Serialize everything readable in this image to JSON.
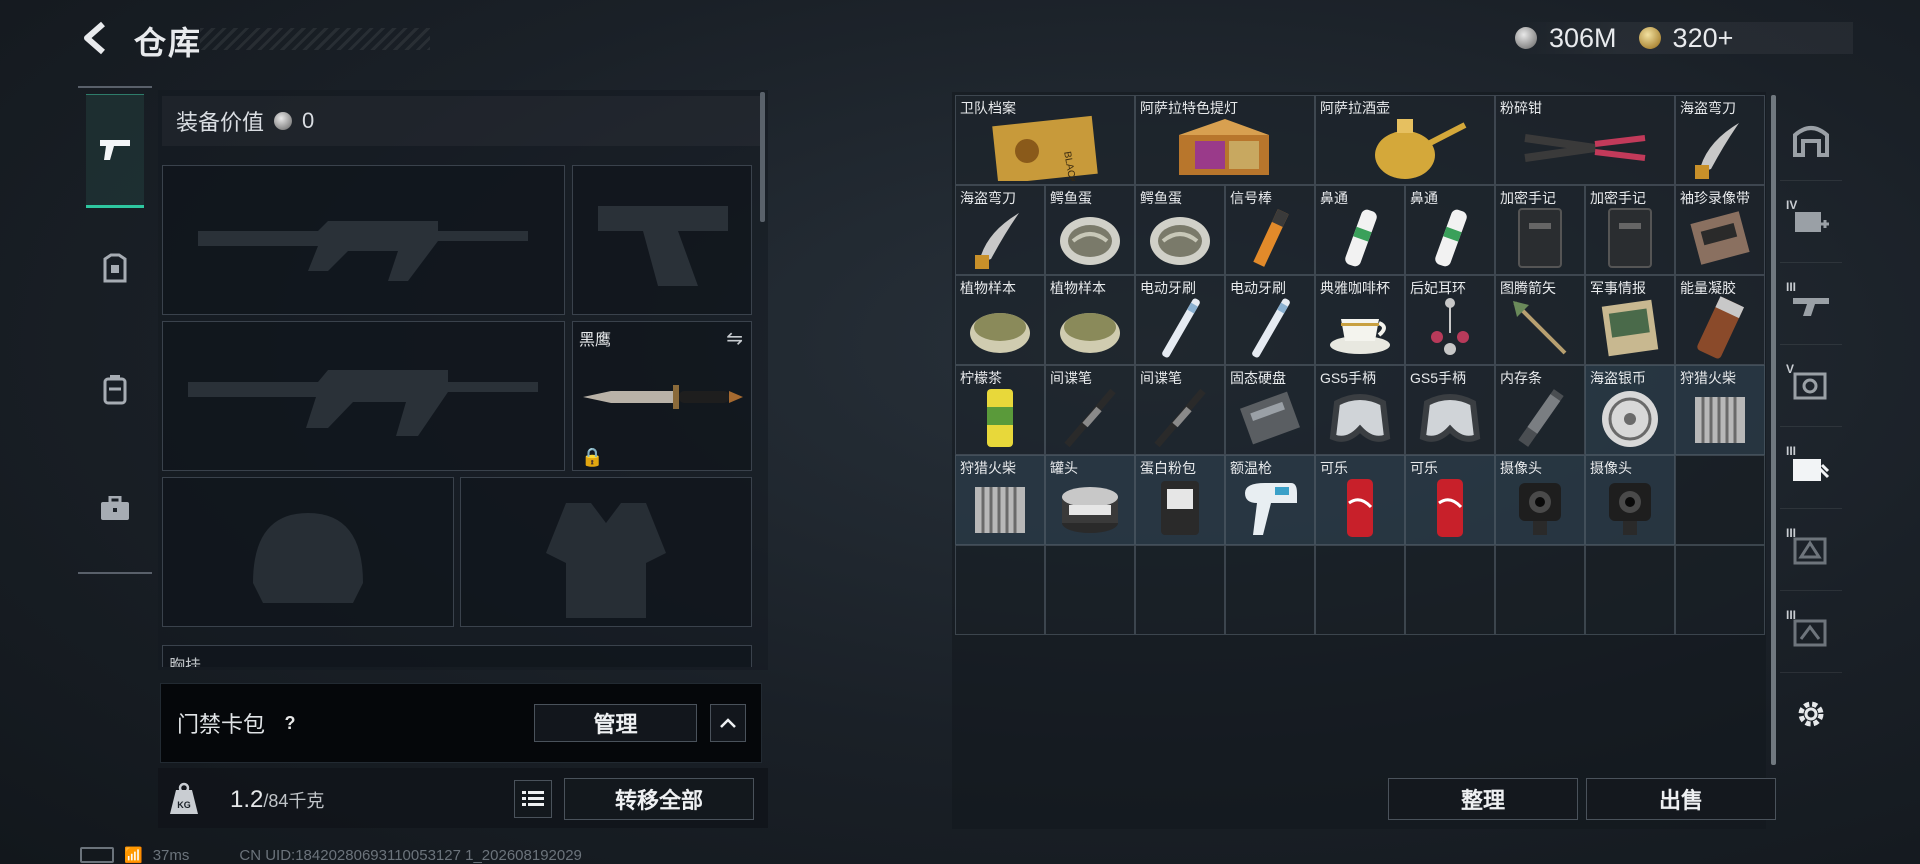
{
  "header": {
    "title": "仓库",
    "silver_amount": "306M",
    "gold_amount": "320+"
  },
  "equipment": {
    "value_label": "装备价值",
    "value": "0",
    "melee_name": "黑鹰",
    "chest_label": "胸挂"
  },
  "card_pack": {
    "label": "门禁卡包",
    "manage_label": "管理"
  },
  "bottom": {
    "weight_current": "1.2",
    "weight_max": "/84千克",
    "transfer_all_label": "转移全部"
  },
  "status": {
    "ping": "37ms",
    "uid": "CN UID:18420280693110053127 1_202608192029"
  },
  "inventory": {
    "items": [
      {
        "name": "卫队档案",
        "icon": "dossier-icon",
        "wide": true,
        "blue": false
      },
      {
        "name": "阿萨拉特色提灯",
        "icon": "lantern-icon",
        "wide": true,
        "blue": false
      },
      {
        "name": "阿萨拉酒壶",
        "icon": "wine-jug-icon",
        "wide": true,
        "blue": false
      },
      {
        "name": "粉碎钳",
        "icon": "pliers-icon",
        "wide": true,
        "blue": false
      },
      {
        "name": "海盗弯刀",
        "icon": "scimitar-icon",
        "wide": false,
        "blue": false
      },
      {
        "name": "海盗弯刀",
        "icon": "scimitar-icon",
        "wide": false,
        "blue": false
      },
      {
        "name": "鳄鱼蛋",
        "icon": "egg-icon",
        "wide": false,
        "blue": false
      },
      {
        "name": "鳄鱼蛋",
        "icon": "egg-icon",
        "wide": false,
        "blue": false
      },
      {
        "name": "信号棒",
        "icon": "flare-icon",
        "wide": false,
        "blue": false
      },
      {
        "name": "鼻通",
        "icon": "inhaler-icon",
        "wide": false,
        "blue": false
      },
      {
        "name": "鼻通",
        "icon": "inhaler-icon",
        "wide": false,
        "blue": false
      },
      {
        "name": "加密手记",
        "icon": "notebook-icon",
        "wide": false,
        "blue": false
      },
      {
        "name": "加密手记",
        "icon": "notebook-icon",
        "wide": false,
        "blue": false
      },
      {
        "name": "袖珍录像带",
        "icon": "tape-icon",
        "wide": false,
        "blue": false
      },
      {
        "name": "植物样本",
        "icon": "sample-jar-icon",
        "wide": false,
        "blue": false
      },
      {
        "name": "植物样本",
        "icon": "sample-jar-icon",
        "wide": false,
        "blue": false
      },
      {
        "name": "电动牙刷",
        "icon": "toothbrush-icon",
        "wide": false,
        "blue": false
      },
      {
        "name": "电动牙刷",
        "icon": "toothbrush-icon",
        "wide": false,
        "blue": false
      },
      {
        "name": "典雅咖啡杯",
        "icon": "coffee-cup-icon",
        "wide": false,
        "blue": false
      },
      {
        "name": "后妃耳环",
        "icon": "earring-icon",
        "wide": false,
        "blue": false
      },
      {
        "name": "图腾箭矢",
        "icon": "arrow-icon",
        "wide": false,
        "blue": false
      },
      {
        "name": "军事情报",
        "icon": "intel-icon",
        "wide": false,
        "blue": false
      },
      {
        "name": "能量凝胶",
        "icon": "gel-icon",
        "wide": false,
        "blue": false
      },
      {
        "name": "柠檬茶",
        "icon": "can-icon",
        "wide": false,
        "blue": false
      },
      {
        "name": "间谍笔",
        "icon": "pen-icon",
        "wide": false,
        "blue": false
      },
      {
        "name": "间谍笔",
        "icon": "pen-icon",
        "wide": false,
        "blue": false
      },
      {
        "name": "固态硬盘",
        "icon": "ssd-icon",
        "wide": false,
        "blue": false
      },
      {
        "name": "GS5手柄",
        "icon": "controller-icon",
        "wide": false,
        "blue": false
      },
      {
        "name": "GS5手柄",
        "icon": "controller-icon",
        "wide": false,
        "blue": false
      },
      {
        "name": "内存条",
        "icon": "ram-icon",
        "wide": false,
        "blue": false
      },
      {
        "name": "海盗银币",
        "icon": "silver-coin-icon",
        "wide": false,
        "blue": true
      },
      {
        "name": "狩猎火柴",
        "icon": "matches-icon",
        "wide": false,
        "blue": true
      },
      {
        "name": "狩猎火柴",
        "icon": "matches-icon",
        "wide": false,
        "blue": true
      },
      {
        "name": "罐头",
        "icon": "tin-icon",
        "wide": false,
        "blue": true
      },
      {
        "name": "蛋白粉包",
        "icon": "powder-bag-icon",
        "wide": false,
        "blue": true
      },
      {
        "name": "额温枪",
        "icon": "thermometer-icon",
        "wide": false,
        "blue": true
      },
      {
        "name": "可乐",
        "icon": "cola-icon",
        "wide": false,
        "blue": true
      },
      {
        "name": "可乐",
        "icon": "cola-icon",
        "wide": false,
        "blue": true
      },
      {
        "name": "摄像头",
        "icon": "camera-icon",
        "wide": false,
        "blue": true
      },
      {
        "name": "摄像头",
        "icon": "camera-icon",
        "wide": false,
        "blue": true
      }
    ],
    "sort_label": "整理",
    "sell_label": "出售"
  },
  "right_nav": {
    "tiers": [
      "IV",
      "III",
      "V",
      "III",
      "III",
      "III"
    ]
  },
  "colors": {
    "accent": "#2ec7a0",
    "cell_border": "#5a6470",
    "blue_cell": "#34485a"
  }
}
